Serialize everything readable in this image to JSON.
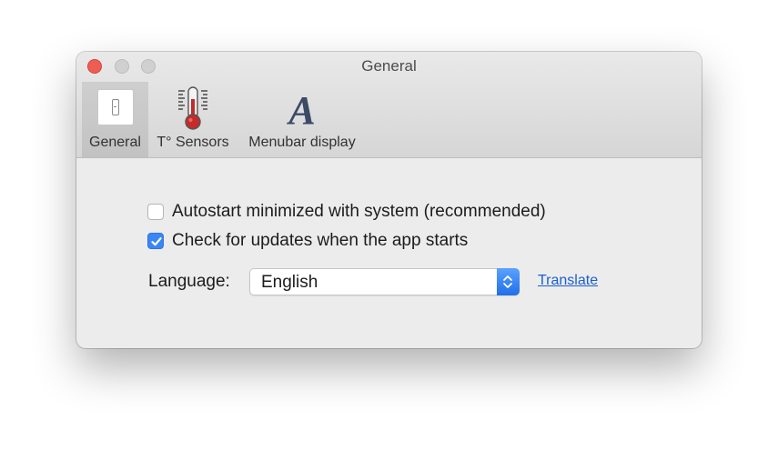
{
  "window": {
    "title": "General"
  },
  "toolbar": {
    "tabs": [
      {
        "label": "General",
        "icon": "switch-icon",
        "selected": true
      },
      {
        "label": "T° Sensors",
        "icon": "thermometer-icon",
        "selected": false
      },
      {
        "label": "Menubar display",
        "icon": "font-a-icon",
        "selected": false
      }
    ]
  },
  "settings": {
    "autostart": {
      "label": "Autostart minimized with system (recommended)",
      "checked": false
    },
    "check_updates": {
      "label": "Check for updates when the app starts",
      "checked": true
    },
    "language": {
      "label": "Language:",
      "selected": "English",
      "translate_link": "Translate"
    }
  },
  "colors": {
    "accent": "#3a86f7",
    "link": "#1a5fd0",
    "close_button": "#ee5d55"
  }
}
